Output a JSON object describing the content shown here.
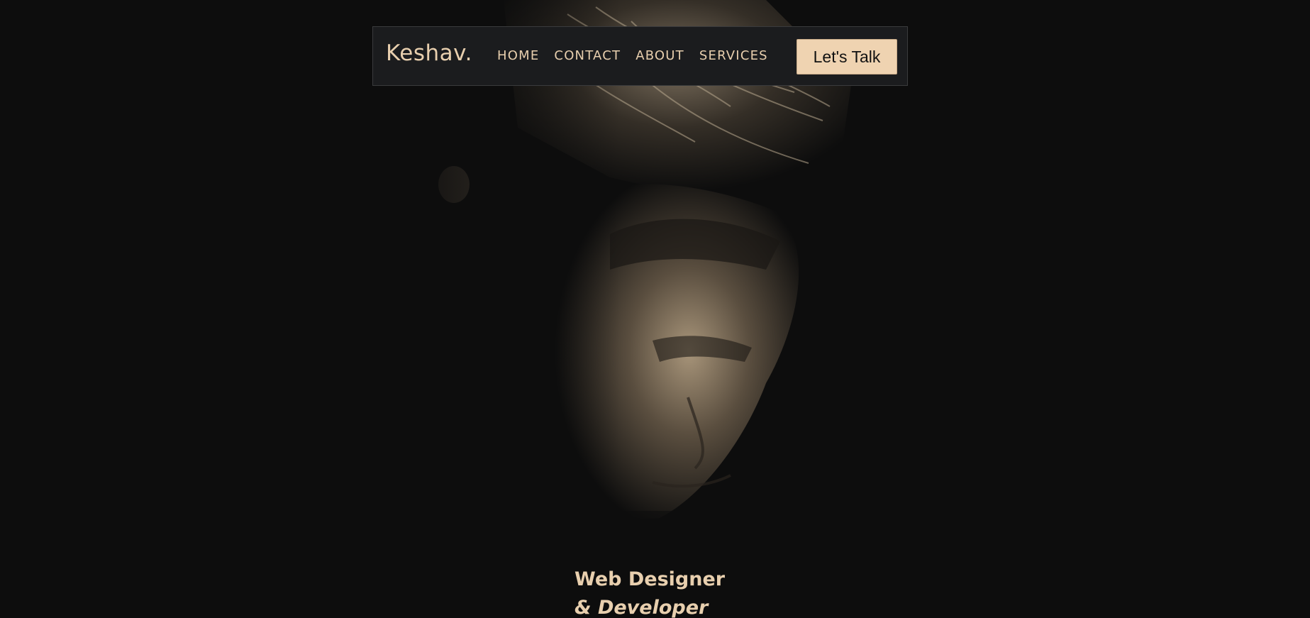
{
  "brand": {
    "name": "Keshav."
  },
  "nav": {
    "links": [
      "HOME",
      "CONTACT",
      "ABOUT",
      "SERVICES"
    ],
    "cta_label": "Let's Talk"
  },
  "hero": {
    "title_line1": "Web Designer",
    "title_line2": "& Developer",
    "photo_icon": "portrait-photo"
  },
  "colors": {
    "background": "#0d0d0d",
    "navbar_bg": "#1b1c1e",
    "accent": "#e8cfae",
    "cta_bg": "#efd3b1"
  }
}
